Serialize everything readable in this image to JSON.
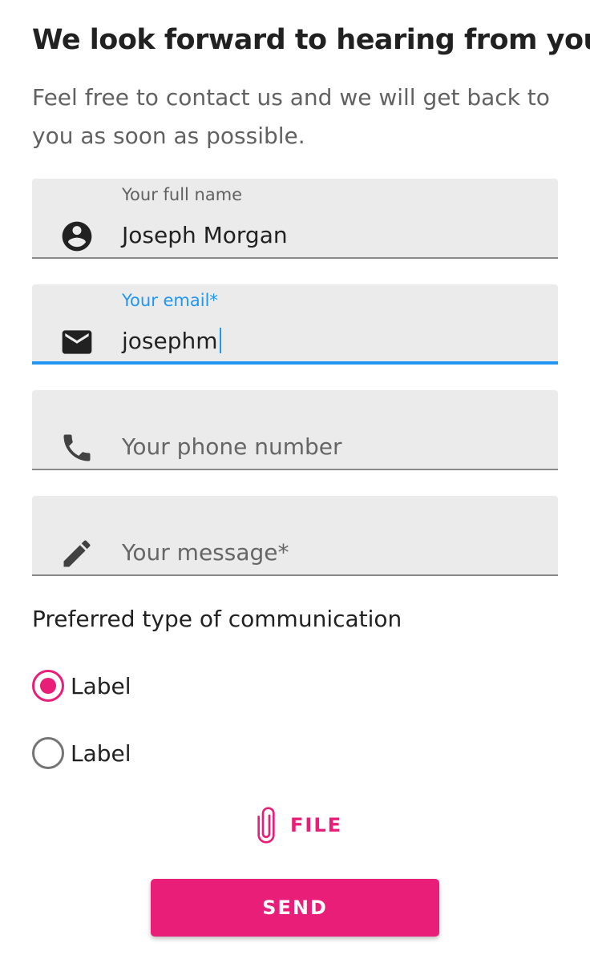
{
  "header": {
    "title": "We look forward to hearing from you",
    "subtitle": "Feel free to contact us and we will get back to you as soon as possible."
  },
  "form": {
    "name_field": {
      "label": "Your full name",
      "value": "Joseph Morgan",
      "icon": "account-circle-icon"
    },
    "email_field": {
      "label": "Your email*",
      "value": "josephm",
      "icon": "email-icon",
      "focused": true
    },
    "phone_field": {
      "placeholder": "Your phone number",
      "icon": "phone-icon"
    },
    "message_field": {
      "placeholder": "Your message*",
      "icon": "pencil-icon"
    },
    "communication": {
      "label": "Preferred type of communication",
      "options": [
        {
          "label": "Label",
          "checked": true
        },
        {
          "label": "Label",
          "checked": false
        }
      ]
    },
    "file_button": {
      "label": "FILE",
      "icon": "paperclip-icon"
    },
    "send_button": {
      "label": "SEND"
    }
  },
  "colors": {
    "accent": "#e91e78",
    "focus": "#2196f3",
    "field_bg": "#ebebeb"
  }
}
